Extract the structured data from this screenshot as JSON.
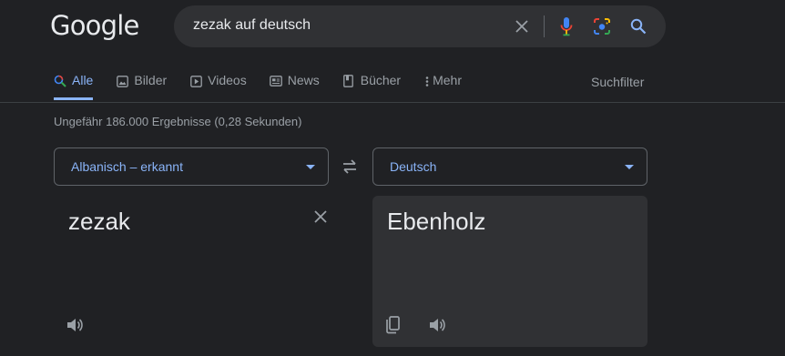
{
  "logo": {
    "letters": [
      "G",
      "o",
      "o",
      "g",
      "l",
      "e"
    ]
  },
  "search": {
    "query": "zezak auf deutsch"
  },
  "tabs": [
    {
      "label": "Alle",
      "icon": "search-icon"
    },
    {
      "label": "Bilder",
      "icon": "image-icon"
    },
    {
      "label": "Videos",
      "icon": "play-icon"
    },
    {
      "label": "News",
      "icon": "newspaper-icon"
    },
    {
      "label": "Bücher",
      "icon": "book-icon"
    },
    {
      "label": "Mehr",
      "icon": "more-vert-icon"
    }
  ],
  "suchfilter": "Suchfilter",
  "stats": "Ungefähr 186.000 Ergebnisse (0,28 Sekunden)",
  "translate": {
    "source_lang": "Albanisch – erkannt",
    "target_lang": "Deutsch",
    "source_text": "zezak",
    "target_text": "Ebenholz"
  },
  "colors": {
    "accent": "#8ab4f8",
    "background": "#202124",
    "panel": "#303134"
  }
}
